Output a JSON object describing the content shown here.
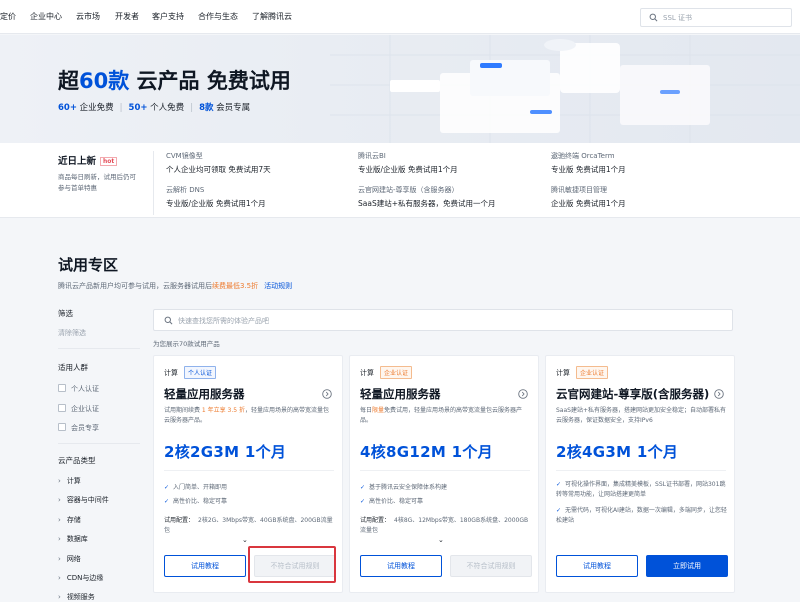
{
  "nav": {
    "items": [
      "定价",
      "企业中心",
      "云市场",
      "开发者",
      "客户支持",
      "合作与生态",
      "了解腾讯云"
    ],
    "search_placeholder": "SSL 证书"
  },
  "hero": {
    "title_prefix": "超",
    "title_count": "60款",
    "title_suffix": " 云产品 免费试用",
    "stats": [
      {
        "num": "60+",
        "label": " 企业免费"
      },
      {
        "num": "50+",
        "label": " 个人免费"
      },
      {
        "num": "8款",
        "label": " 会员专属"
      }
    ]
  },
  "updates": {
    "title": "近日上新",
    "hot": "hot",
    "desc": "商品每日刷新，试用后仍可参与首单特惠",
    "items": [
      {
        "name": "CVM镜像型",
        "note": "个人企业均可领取  免费试用7天"
      },
      {
        "name": "腾讯云BI",
        "note": "专业版/企业版  免费试用1个月"
      },
      {
        "name": "遨驰终端 OrcaTerm",
        "note": "专业版  免费试用1个月"
      },
      {
        "name": "云解析 DNS",
        "note": "专业版/企业版  免费试用1个月"
      },
      {
        "name": "云官网建站-尊享版（含服务器）",
        "note": "SaaS建站+私有服务器，免费试用一个月"
      },
      {
        "name": "腾讯敏捷项目管理",
        "note": "企业版  免费试用1个月"
      }
    ]
  },
  "section": {
    "title": "试用专区",
    "desc_prefix": "腾讯云产品新用户均可参与试用，云服务器试用后",
    "desc_highlight": "续费最低3.5折",
    "desc_link": "活动规则"
  },
  "filter": {
    "title": "筛选",
    "clear": "清除筛选",
    "group1_title": "适用人群",
    "group1_options": [
      "个人认证",
      "企业认证",
      "会员专享"
    ],
    "group2_title": "云产品类型",
    "categories": [
      "计算",
      "容器与中间件",
      "存储",
      "数据库",
      "网络",
      "CDN与边缘",
      "视频服务"
    ]
  },
  "search": {
    "placeholder": "快速查找您所需的体验产品吧",
    "count": "为您展示70款试用产品"
  },
  "cards": [
    {
      "category": "计算",
      "tag": "个人认证",
      "name": "轻量应用服务器",
      "desc_pre": "试用期间续费 ",
      "desc_hl": "1 年立享 3.5 折",
      "desc_post": "，轻量应用场景的高带宽流量包云服务器产品。",
      "spec": "2核2G3M  1个月",
      "features": [
        "入门简单、开箱即用",
        "高性价比、稳定可靠"
      ],
      "config_label": "试用配置：",
      "config": "2核2G、3Mbps带宽、40GB系统盘、200GB流量包",
      "more": "⌄",
      "btn1": "试用教程",
      "btn2": "不符合试用规则"
    },
    {
      "category": "计算",
      "tag": "企业认证",
      "name": "轻量应用服务器",
      "desc_pre": "每日",
      "desc_hl": "限量",
      "desc_post": "免费试用，轻量应用场景的高带宽流量包云服务器产品。",
      "spec": "4核8G12M  1个月",
      "features": [
        "基于腾讯云安全保障体系构建",
        "高性价比、稳定可靠"
      ],
      "config_label": "试用配置：",
      "config": "4核8G、12Mbps带宽、180GB系统盘、2000GB流量包",
      "more": "⌄",
      "btn1": "试用教程",
      "btn2": "不符合试用规则"
    },
    {
      "category": "计算",
      "tag": "企业认证",
      "name": "云官网建站-尊享版(含服务器)",
      "desc_pre": "SaaS建站+私有服务器，搭建网站更加安全稳定；自动部署私有云服务器，保证数据安全，支持IPv6",
      "desc_hl": "",
      "desc_post": "",
      "spec": "2核4G3M  1个月",
      "features": [
        "可视化操作界面，集成精美模板，SSL证书部署，网站301跳转等常用功能，让网站搭建更简单",
        "无需代码，可视化AI建站，数据一次编辑，多端同步，让您轻松建站"
      ],
      "config_label": "",
      "config": "",
      "more": "",
      "btn1": "试用教程",
      "btn2": "立即试用"
    }
  ],
  "colors": {
    "accent": "#0052d9",
    "highlight": "#d9363e",
    "orange": "#ed7b2f"
  }
}
